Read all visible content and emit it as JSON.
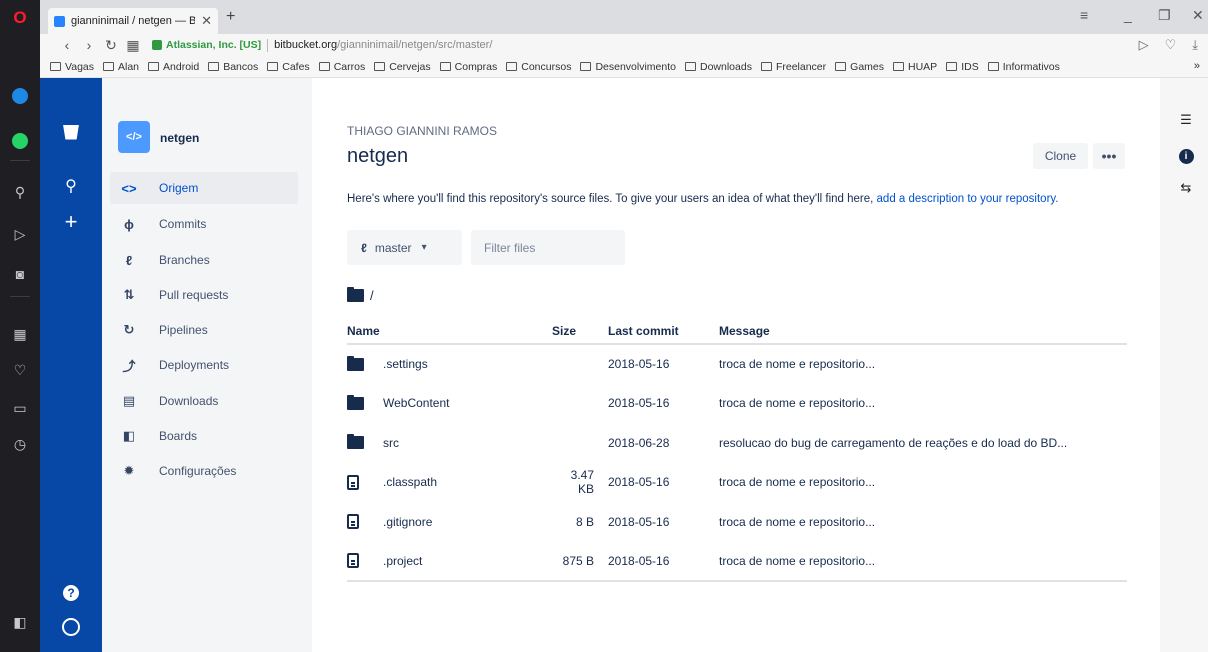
{
  "browser": {
    "tab_title": "gianninimail / netgen — B",
    "cert_label": "Atlassian, Inc. [US]",
    "url_domain": "bitbucket.org",
    "url_path": "/gianninimail/netgen/src/master/",
    "bookmarks": [
      "Vagas",
      "Alan",
      "Android",
      "Bancos",
      "Cafes",
      "Carros",
      "Cervejas",
      "Compras",
      "Concursos",
      "Desenvolvimento",
      "Downloads",
      "Freelancer",
      "Games",
      "HUAP",
      "IDS",
      "Informativos"
    ],
    "bookmarks_more": "»"
  },
  "sidebar": {
    "repo_name": "netgen",
    "repo_avatar": "</>",
    "items": [
      {
        "label": "Origem",
        "icon": "code-icon",
        "glyph": "<>"
      },
      {
        "label": "Commits",
        "icon": "commit-icon",
        "glyph": "ϕ"
      },
      {
        "label": "Branches",
        "icon": "branch-icon",
        "glyph": "ℓ"
      },
      {
        "label": "Pull requests",
        "icon": "pull-request-icon",
        "glyph": "⇅"
      },
      {
        "label": "Pipelines",
        "icon": "pipeline-icon",
        "glyph": "↻"
      },
      {
        "label": "Deployments",
        "icon": "deployment-icon",
        "glyph": "⤴"
      },
      {
        "label": "Downloads",
        "icon": "download-icon",
        "glyph": "▤"
      },
      {
        "label": "Boards",
        "icon": "board-icon",
        "glyph": "◧"
      },
      {
        "label": "Configurações",
        "icon": "gear-icon",
        "glyph": "✹"
      }
    ]
  },
  "main": {
    "owner": "THIAGO GIANNINI RAMOS",
    "title": "netgen",
    "clone_label": "Clone",
    "more_label": "•••",
    "description": "Here's where you'll find this repository's source files. To give your users an idea of what they'll find here,",
    "description_link": "add a description to your repository.",
    "branch": "master",
    "filter_placeholder": "Filter files",
    "path": "/",
    "columns": {
      "name": "Name",
      "size": "Size",
      "last_commit": "Last commit",
      "message": "Message"
    },
    "files": [
      {
        "type": "folder",
        "name": ".settings",
        "size": "",
        "date": "2018-05-16",
        "message": "troca de nome e repositorio..."
      },
      {
        "type": "folder",
        "name": "WebContent",
        "size": "",
        "date": "2018-05-16",
        "message": "troca de nome e repositorio..."
      },
      {
        "type": "folder",
        "name": "src",
        "size": "",
        "date": "2018-06-28",
        "message": "resolucao do bug de carregamento de reações e do load do BD..."
      },
      {
        "type": "file",
        "name": ".classpath",
        "size": "3.47 KB",
        "date": "2018-05-16",
        "message": "troca de nome e repositorio..."
      },
      {
        "type": "file",
        "name": ".gitignore",
        "size": "8 B",
        "date": "2018-05-16",
        "message": "troca de nome e repositorio..."
      },
      {
        "type": "file",
        "name": ".project",
        "size": "875 B",
        "date": "2018-05-16",
        "message": "troca de nome e repositorio..."
      }
    ]
  },
  "colors": {
    "global_nav": "#0747a6",
    "link": "#0052cc",
    "sidebar_bg": "#f4f5f7"
  }
}
